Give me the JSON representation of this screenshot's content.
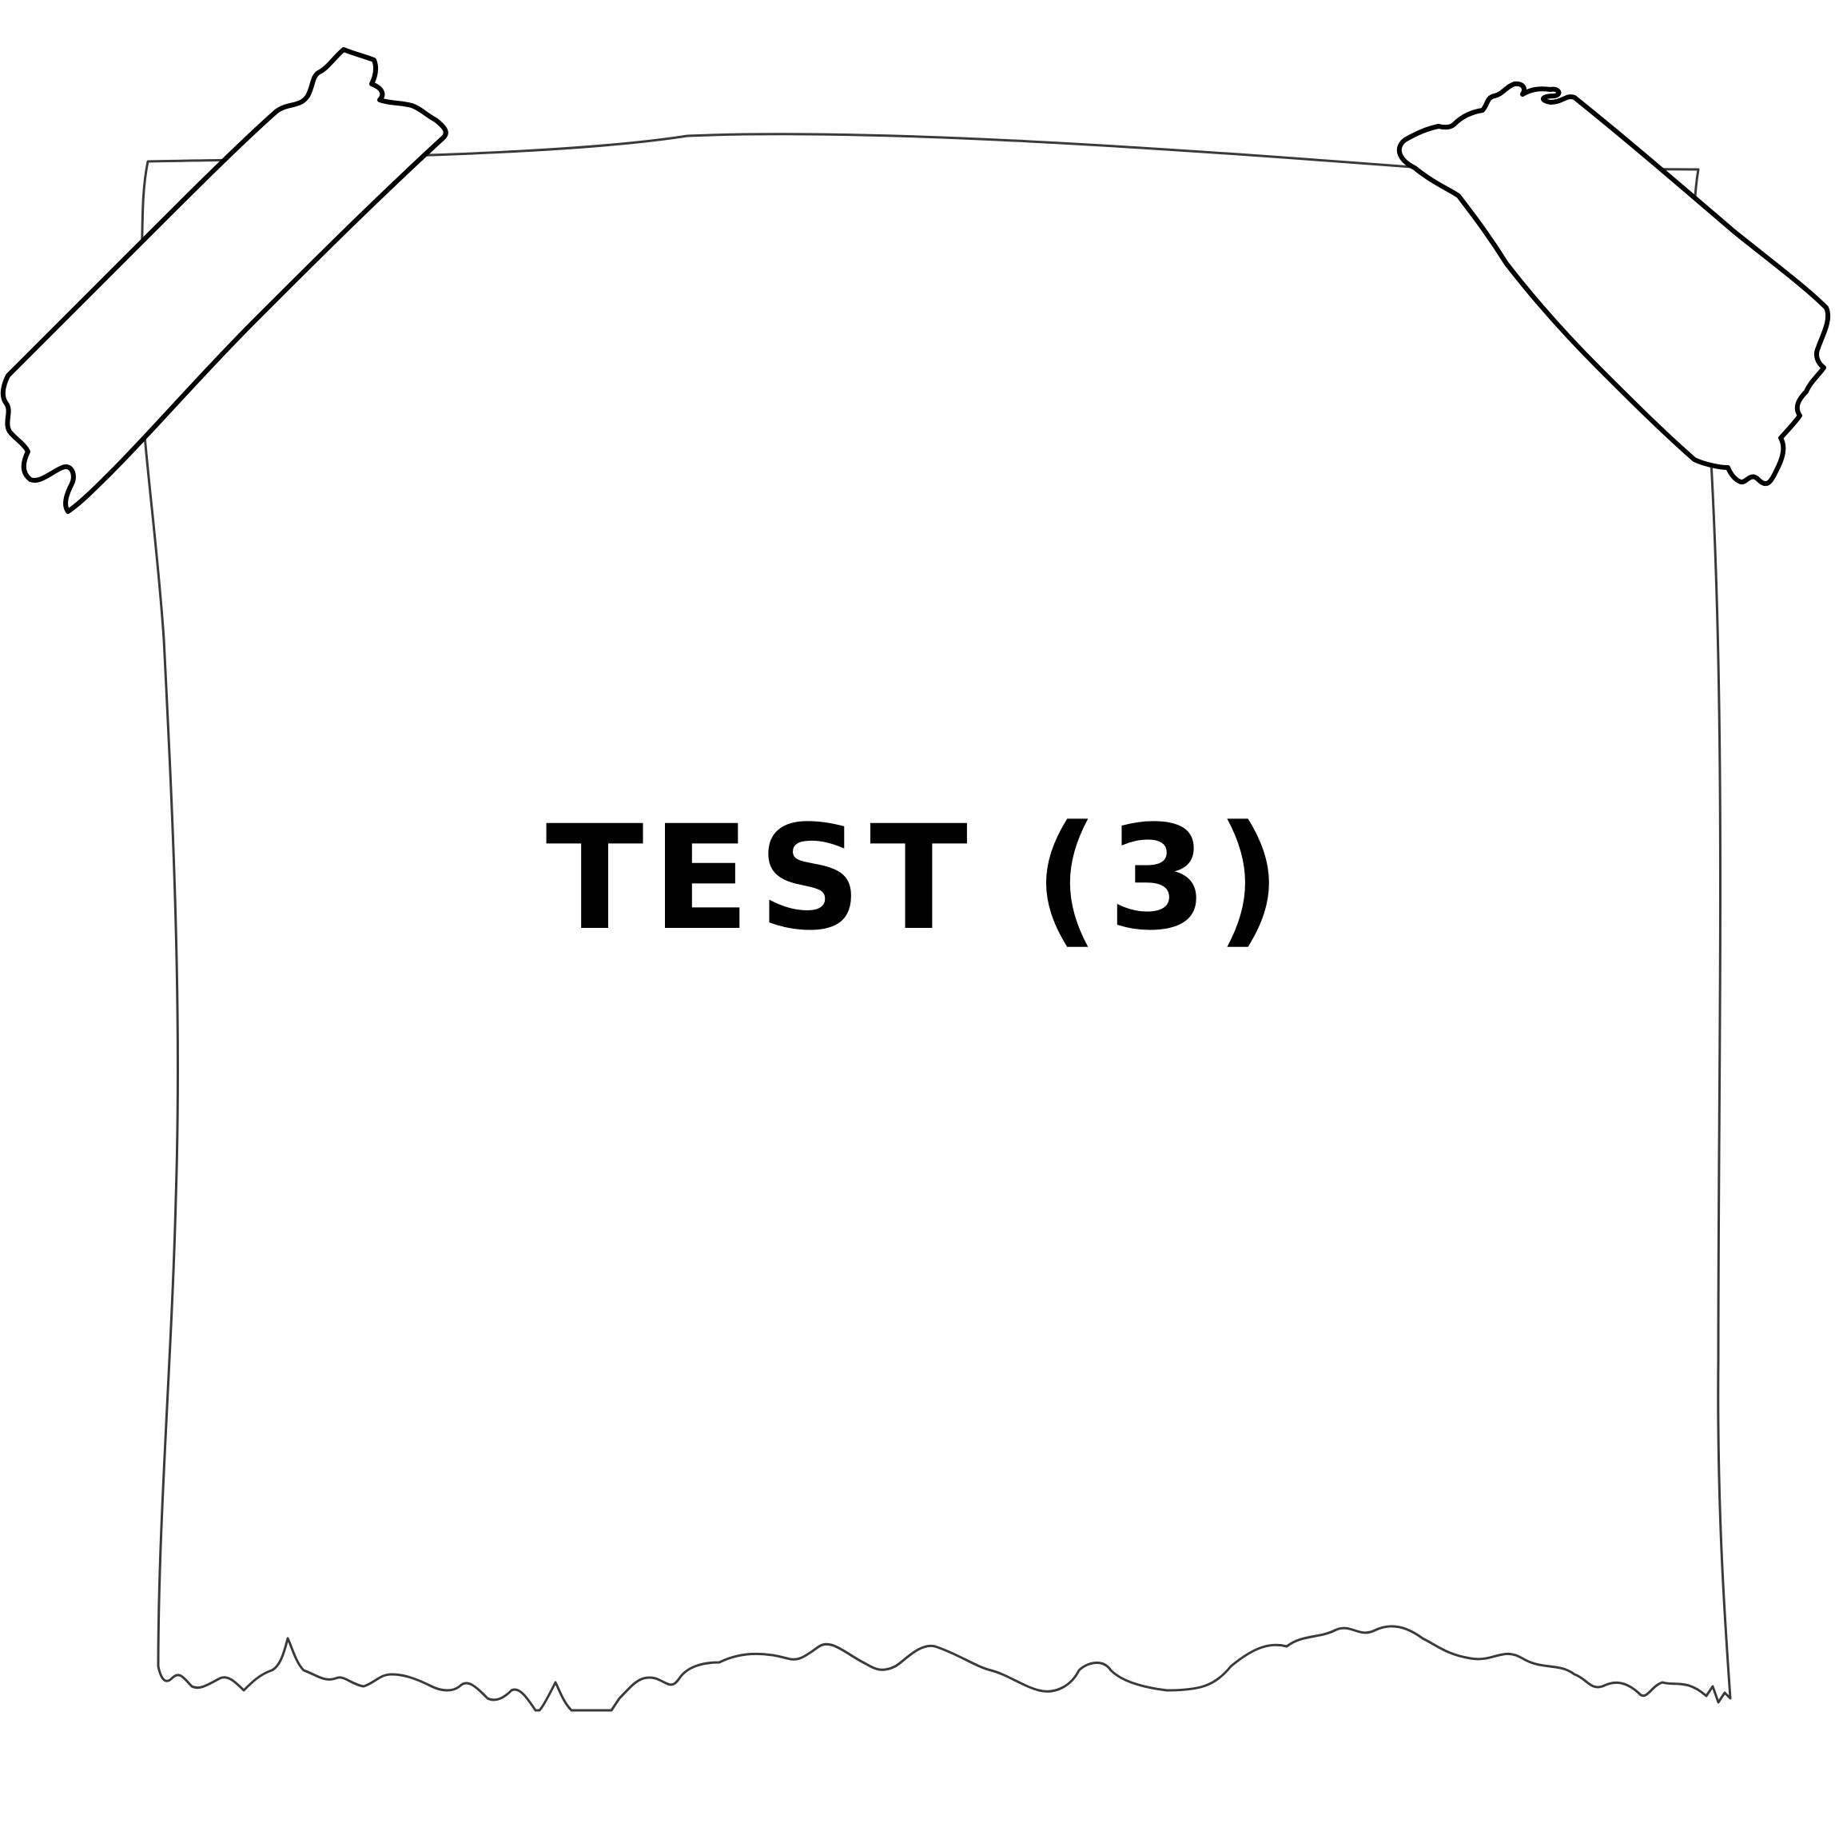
{
  "note": {
    "text": "TEST (3)"
  },
  "colors": {
    "background": "#ffffff",
    "outline": "#000000",
    "paper_edge": "#3a3a3a",
    "text": "#000000"
  }
}
